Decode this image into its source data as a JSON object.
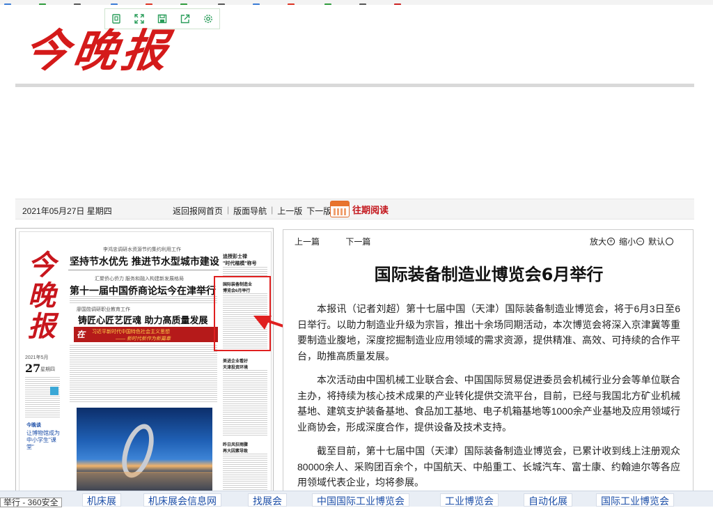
{
  "toolbar": {
    "icons": [
      "copy-icon",
      "expand-icon",
      "save-icon",
      "share-icon",
      "settings-icon"
    ]
  },
  "logo": {
    "text": "今晚报"
  },
  "navbar": {
    "date": "2021年05月27日 星期四",
    "links": [
      "返回报网首页",
      "版面导航",
      "上一版",
      "下一版"
    ],
    "past_issues": "往期阅读"
  },
  "paper": {
    "masthead": "今晚报",
    "headline_1_sub": "李鸿忠调研水资源节约集约利用工作",
    "headline_1": "坚持节水优先 推进节水型城市建设",
    "headline_2_sub": "汇聚侨心侨力 服务和融入构建新发展格局",
    "headline_2": "第十一届中国侨商论坛今在津举行",
    "headline_3_sub": "廖国勋调研职业教育工作",
    "headline_3": "铸匠心匠艺匠魂 助力高质量发展",
    "side_1": "追授彭士禄\n\"时代楷模\"称号",
    "side_2": "国际装备制造业\n博览会6月举行",
    "side_3": "美进企业看好\n天津投资环境",
    "side_4": "昨日风狂雨骤\n再大因素导致",
    "banner_char": "在",
    "banner_top": "习近平新时代中国特色社会主义思想",
    "banner_bottom": "—— 新时代新作为新篇章",
    "date_year": "2021年5月",
    "date_day": "27",
    "date_week": "星期四",
    "left_tag": "今晚谈",
    "left_text": "让博物馆成为中小学生\"课堂\""
  },
  "article": {
    "prev": "上一篇",
    "next": "下一篇",
    "zoom_in": "放大",
    "zoom_out": "缩小",
    "default": "默认",
    "title": "国际装备制造业博览会6月举行",
    "paragraphs": [
      "本报讯（记者刘超）第十七届中国（天津）国际装备制造业博览会，将于6月3日至6日举行。以助力制造业升级为宗旨，推出十余场同期活动，本次博览会将深入京津冀等重要制造业腹地，深度挖掘制造业应用领域的需求资源，提供精准、高效、可持续的合作平台，助推高质量发展。",
      "本次活动由中国机械工业联合会、中国国际贸易促进委员会机械行业分会等单位联合主办，将持续为核心技术成果的产业转化提供交流平台，目前，已经与我国北方矿业机械基地、建筑支护装备基地、食品加工基地、电子机箱基地等1000余产业基地及应用领域行业商协会，形成深度合作，提供设备及技术支持。",
      "截至目前，第十七届中国（天津）国际装备制造业博览会，已累计收到线上注册观众80000余人、采购团百余个，中国航天、中船重工、长城汽车、富士康、约翰迪尔等各应用领域代表企业，均将参展。"
    ]
  },
  "bottom": {
    "status": "举行 - 360安全",
    "links": [
      "机床展",
      "机床展会信息网",
      "找展会",
      "中国国际工业博览会",
      "工业博览会",
      "自动化展",
      "国际工业博览会"
    ]
  }
}
